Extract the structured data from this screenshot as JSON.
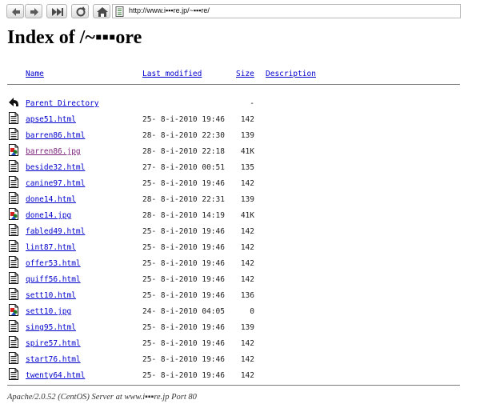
{
  "browser": {
    "url": "http://www.i▪▪▪re.jp/~▪▪▪re/"
  },
  "page": {
    "title": "Index of /~▪▪▪ore",
    "columns": {
      "name": "Name",
      "last_modified": "Last modified",
      "size": "Size",
      "description": "Description"
    },
    "parent": {
      "name": "Parent Directory",
      "size": "-"
    },
    "files": [
      {
        "name": "apse51.html",
        "date": "25- 8-i-2010 19:46",
        "size": "142",
        "type": "text"
      },
      {
        "name": "barren86.html",
        "date": "28- 8-i-2010 22:30",
        "size": "139",
        "type": "text"
      },
      {
        "name": "barren86.jpg",
        "date": "28- 8-i-2010 22:18",
        "size": "41K",
        "type": "image"
      },
      {
        "name": "beside32.html",
        "date": "27- 8-i-2010 00:51",
        "size": "135",
        "type": "text"
      },
      {
        "name": "canine97.html",
        "date": "25- 8-i-2010 19:46",
        "size": "142",
        "type": "text"
      },
      {
        "name": "done14.html",
        "date": "28- 8-i-2010 22:31",
        "size": "139",
        "type": "text"
      },
      {
        "name": "done14.jpg",
        "date": "28- 8-i-2010 14:19",
        "size": "41K",
        "type": "image"
      },
      {
        "name": "fabled49.html",
        "date": "25- 8-i-2010 19:46",
        "size": "142",
        "type": "text"
      },
      {
        "name": "lint87.html",
        "date": "25- 8-i-2010 19:46",
        "size": "142",
        "type": "text"
      },
      {
        "name": "offer53.html",
        "date": "25- 8-i-2010 19:46",
        "size": "142",
        "type": "text"
      },
      {
        "name": "quiff56.html",
        "date": "25- 8-i-2010 19:46",
        "size": "142",
        "type": "text"
      },
      {
        "name": "sett10.html",
        "date": "25- 8-i-2010 19:46",
        "size": "136",
        "type": "text"
      },
      {
        "name": "sett10.jpg",
        "date": "24- 8-i-2010 04:05",
        "size": "0",
        "type": "image"
      },
      {
        "name": "sing95.html",
        "date": "25- 8-i-2010 19:46",
        "size": "139",
        "type": "text"
      },
      {
        "name": "spire57.html",
        "date": "25- 8-i-2010 19:46",
        "size": "142",
        "type": "text"
      },
      {
        "name": "start76.html",
        "date": "25- 8-i-2010 19:46",
        "size": "142",
        "type": "text"
      },
      {
        "name": "twenty64.html",
        "date": "25- 8-i-2010 19:46",
        "size": "142",
        "type": "text"
      }
    ],
    "footer": "Apache/2.0.52 (CentOS) Server at www.i▪▪▪re.jp Port 80"
  },
  "colors": {
    "link": "#0000cc",
    "visited_link": "#7a1f7a",
    "rule": "#7a7a7a"
  },
  "icons": {
    "text_file": "text-file-icon",
    "image_file": "image-file-icon",
    "parent": "back-arrow-icon"
  }
}
